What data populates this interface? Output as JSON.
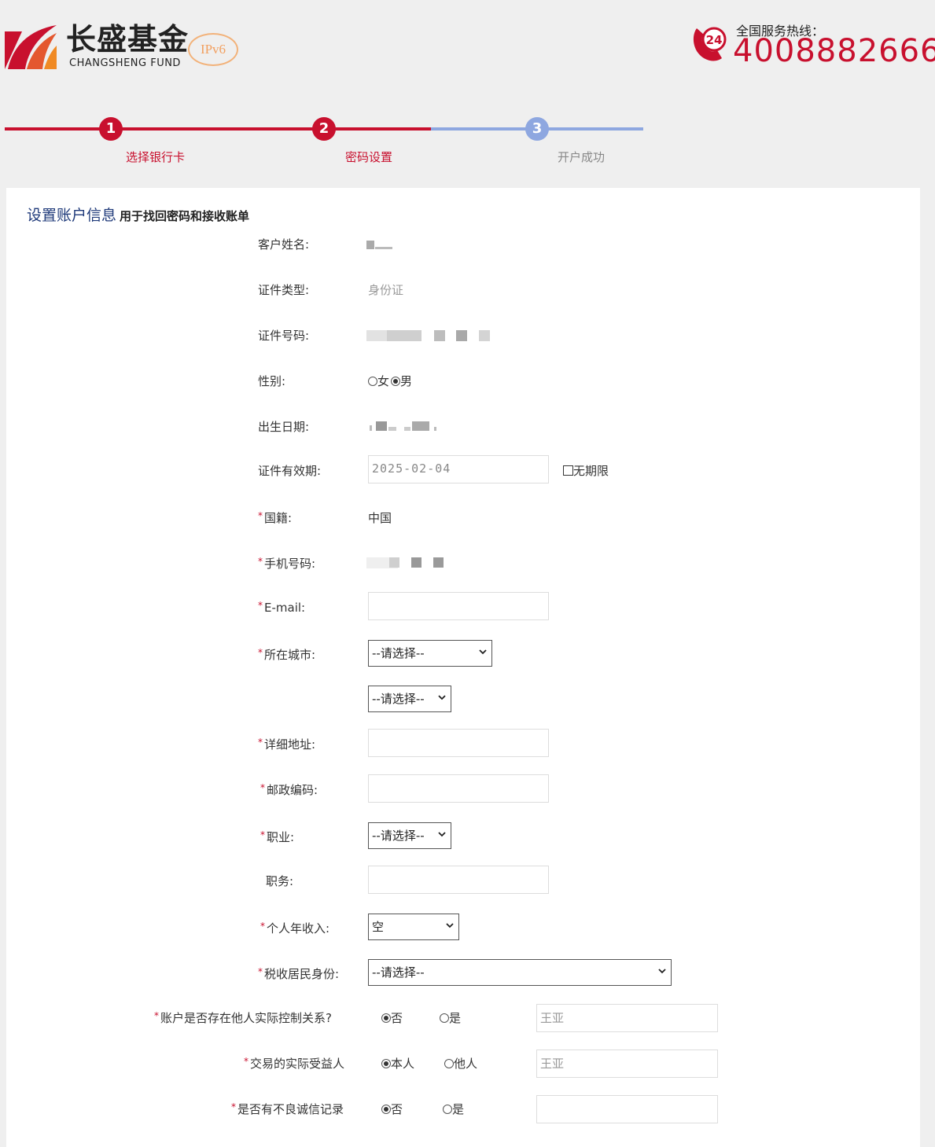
{
  "brand": {
    "name_cn": "长盛基金",
    "name_en": "CHANGSHENG FUND",
    "ipv6": "IPv6",
    "hotline_label": "全国服务热线：",
    "hotline_number": "4008882666",
    "phone_badge": "24",
    "colors": {
      "brand_red": "#c8102e",
      "step_blue": "#8ea7e0",
      "title_blue": "#1f3a7a"
    }
  },
  "steps": [
    {
      "num": "1",
      "label": "选择银行卡",
      "state": "done"
    },
    {
      "num": "2",
      "label": "密码设置",
      "state": "current"
    },
    {
      "num": "3",
      "label": "开户成功",
      "state": "todo"
    }
  ],
  "section": {
    "title": "设置账户信息",
    "subtitle": "用于找回密码和接收账单"
  },
  "form": {
    "name": {
      "label": "客户姓名:"
    },
    "id_type": {
      "label": "证件类型:",
      "value": "身份证"
    },
    "id_number": {
      "label": "证件号码:"
    },
    "gender": {
      "label": "性别:",
      "options": [
        "女",
        "男"
      ],
      "selected": "男"
    },
    "birth": {
      "label": "出生日期:"
    },
    "id_valid": {
      "label": "证件有效期:",
      "value": "2025-02-04",
      "no_expiry_label": "无期限"
    },
    "nationality": {
      "label": "国籍:",
      "value": "中国"
    },
    "mobile": {
      "label": "手机号码:"
    },
    "email": {
      "label": "E-mail:",
      "value": ""
    },
    "city": {
      "label": "所在城市:",
      "province_value": "--请选择--",
      "city_value": "--请选择--"
    },
    "address": {
      "label": "详细地址:",
      "value": ""
    },
    "postcode": {
      "label": "邮政编码:",
      "value": ""
    },
    "occupation": {
      "label": "职业:",
      "value": "--请选择--"
    },
    "position": {
      "label": "职务:",
      "value": ""
    },
    "income": {
      "label": "个人年收入:",
      "value": "空"
    },
    "tax": {
      "label": "税收居民身份:",
      "value": "--请选择--"
    },
    "control": {
      "label": "账户是否存在他人实际控制关系?",
      "options": [
        "否",
        "是"
      ],
      "selected": "否",
      "input_value": "王亚"
    },
    "beneficiary": {
      "label": "交易的实际受益人",
      "options": [
        "本人",
        "他人"
      ],
      "selected": "本人",
      "input_value": "王亚"
    },
    "credit": {
      "label": "是否有不良诚信记录",
      "options": [
        "否",
        "是"
      ],
      "selected": "否",
      "input_value": ""
    }
  },
  "icons": {
    "dropdown": "chevron-down-icon",
    "phone": "phone-24h-icon",
    "logo": "changsheng-logo-mark"
  }
}
